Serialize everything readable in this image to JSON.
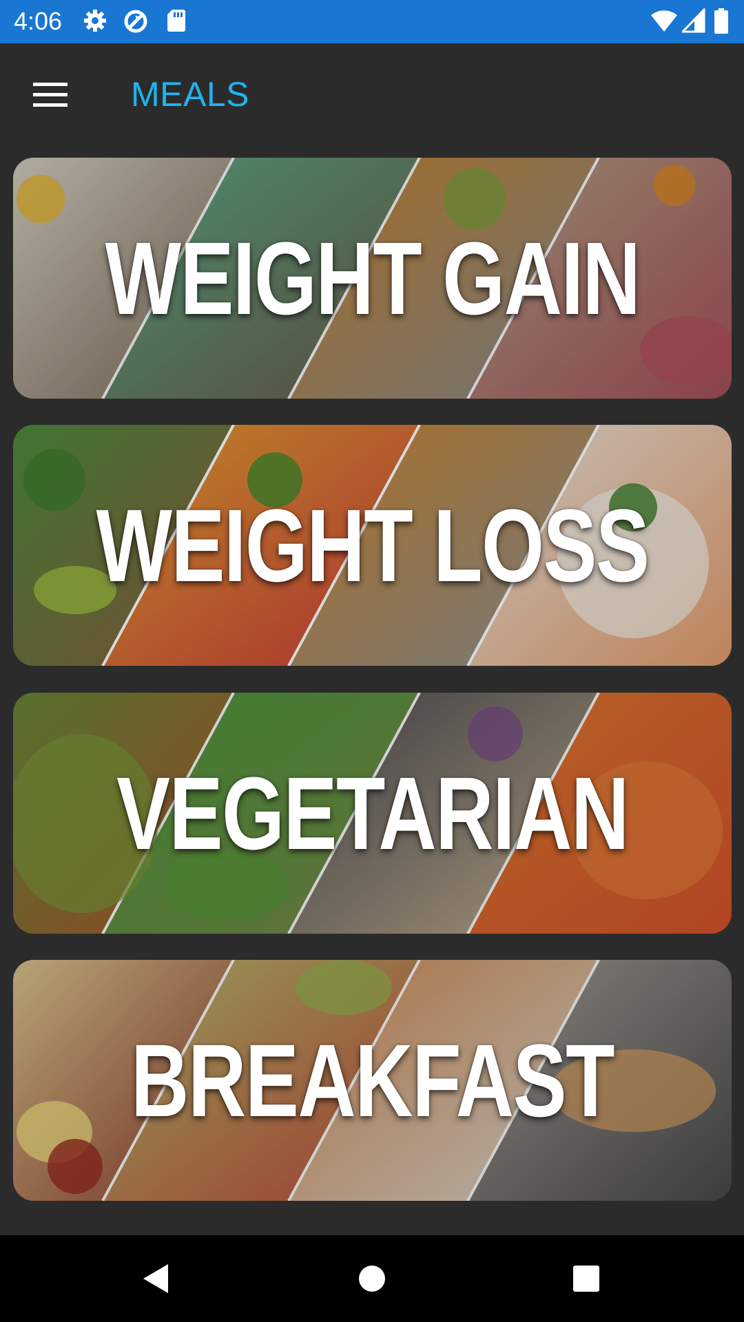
{
  "status_bar": {
    "time": "4:06",
    "left_icons": [
      "gear-icon",
      "data-saver-icon",
      "sd-card-icon"
    ],
    "right_icons": [
      "wifi-icon",
      "cell-signal-icon",
      "battery-icon"
    ],
    "color": "#1976d2"
  },
  "app_bar": {
    "menu_icon": "hamburger-menu-icon",
    "title": "MEALS",
    "title_color": "#1fb4ee",
    "background": "#2b2b2b"
  },
  "meal_categories": [
    {
      "label": "WEIGHT GAIN"
    },
    {
      "label": "WEIGHT LOSS"
    },
    {
      "label": "VEGETARIAN"
    },
    {
      "label": "BREAKFAST"
    }
  ],
  "nav_bar": {
    "back_icon": "back-triangle-icon",
    "home_icon": "home-circle-icon",
    "recents_icon": "recents-square-icon"
  }
}
